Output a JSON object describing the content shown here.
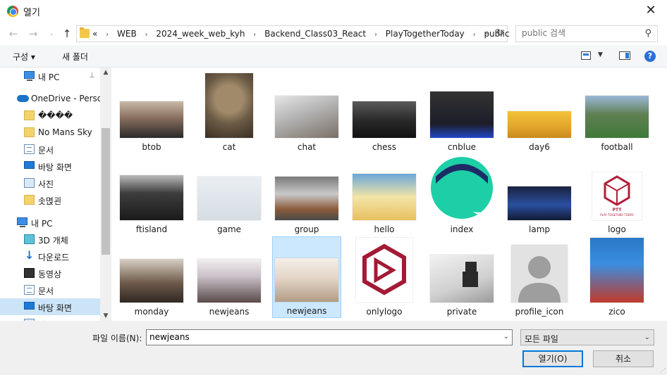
{
  "window": {
    "title": "열기",
    "close_glyph": "✕",
    "app_icon": "chrome-icon"
  },
  "nav_buttons": {
    "back": "←",
    "forward": "→",
    "recent": "⌄",
    "up": "↑"
  },
  "address": {
    "overflow": "«",
    "separator": "›",
    "crumbs": [
      "WEB",
      "2024_week_web_kyh",
      "Backend_Class03_React",
      "PlayTogetherToday",
      "public"
    ],
    "dropdown_glyph": "⌄",
    "refresh_glyph": "↻"
  },
  "search": {
    "placeholder": "public 검색",
    "icon": "search-icon",
    "glyph": "⚲"
  },
  "toolbar": {
    "organize_label": "구성 ▾",
    "new_folder_label": "새 폴더",
    "view_dropdown": "▼",
    "help_label": "?"
  },
  "sidebar": {
    "pin_glyph": "📌",
    "items": [
      {
        "label": "내 PC",
        "icon": "pc-icon",
        "indent": 1
      },
      {
        "label": "OneDrive - Personal",
        "icon": "cloud-icon",
        "indent": 0
      },
      {
        "label": "����",
        "icon": "folder-icon",
        "indent": 1
      },
      {
        "label": "No Mans Sky",
        "icon": "folder-icon",
        "indent": 1
      },
      {
        "label": "문서",
        "icon": "document-icon",
        "indent": 1
      },
      {
        "label": "바탕 화면",
        "icon": "desktop-icon",
        "indent": 1
      },
      {
        "label": "사진",
        "icon": "pictures-icon",
        "indent": 1
      },
      {
        "label": "솟멵괸",
        "icon": "folder-icon",
        "indent": 1
      },
      {
        "label": "내 PC",
        "icon": "pc-icon",
        "indent": 0
      },
      {
        "label": "3D 개체",
        "icon": "3d-objects-icon",
        "indent": 1
      },
      {
        "label": "다운로드",
        "icon": "download-icon",
        "indent": 1
      },
      {
        "label": "동영상",
        "icon": "video-icon",
        "indent": 1
      },
      {
        "label": "문서",
        "icon": "document-icon",
        "indent": 1
      },
      {
        "label": "바탕 화면",
        "icon": "desktop-icon",
        "indent": 1,
        "selected": true
      },
      {
        "label": "사진",
        "icon": "pictures-icon",
        "indent": 1
      }
    ],
    "scroll_up": "▲",
    "scroll_down": "▼"
  },
  "files": [
    {
      "name": "btob"
    },
    {
      "name": "cat"
    },
    {
      "name": "chat"
    },
    {
      "name": "chess"
    },
    {
      "name": "cnblue"
    },
    {
      "name": "day6"
    },
    {
      "name": "football"
    },
    {
      "name": "ftisland"
    },
    {
      "name": "game"
    },
    {
      "name": "group"
    },
    {
      "name": "hello"
    },
    {
      "name": "index"
    },
    {
      "name": "lamp"
    },
    {
      "name": "logo",
      "thumb_text": "PTT",
      "thumb_subtext": "PLAY TOGETHER TODAY"
    },
    {
      "name": "monday"
    },
    {
      "name": "newjeans"
    },
    {
      "name": "newjeans",
      "selected": true
    },
    {
      "name": "onlylogo"
    },
    {
      "name": "private"
    },
    {
      "name": "profile_icon"
    },
    {
      "name": "zico"
    }
  ],
  "footer": {
    "filename_label": "파일 이름(N):",
    "filename_value": "newjeans",
    "filename_dropdown": "⌄",
    "filetype_value": "모든 파일",
    "filetype_dropdown": "⌄",
    "open_label": "열기(O)",
    "cancel_label": "취소",
    "resize_glyph": "⋰"
  },
  "colors": {
    "accent": "#0078d7",
    "selection_bg": "#cce8ff",
    "toolbar_bg": "#f5f6f7",
    "footer_bg": "#f0f0f0"
  }
}
